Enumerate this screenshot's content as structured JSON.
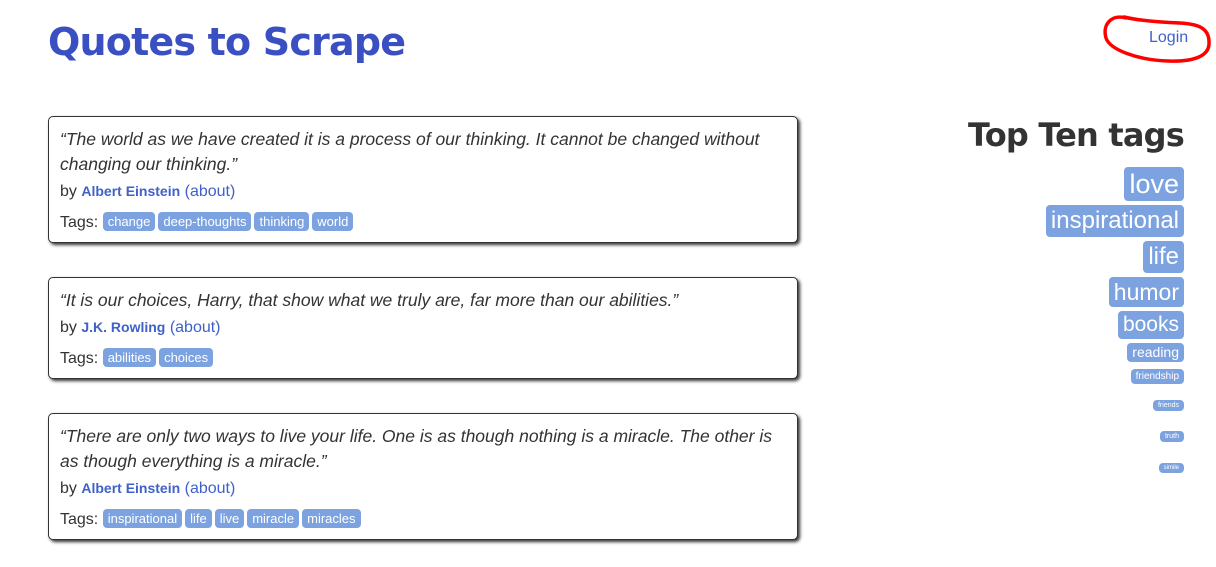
{
  "header": {
    "title": "Quotes to Scrape",
    "login_label": "Login"
  },
  "annotation_color": "#ff0000",
  "quotes": [
    {
      "text": "“The world as we have created it is a process of our thinking. It cannot be changed without changing our thinking.”",
      "by_label": "by",
      "author": "Albert Einstein",
      "about_label": "(about)",
      "tags_label": "Tags:",
      "tags": [
        "change",
        "deep-thoughts",
        "thinking",
        "world"
      ]
    },
    {
      "text": "“It is our choices, Harry, that show what we truly are, far more than our abilities.”",
      "by_label": "by",
      "author": "J.K. Rowling",
      "about_label": "(about)",
      "tags_label": "Tags:",
      "tags": [
        "abilities",
        "choices"
      ]
    },
    {
      "text": "“There are only two ways to live your life. One is as though nothing is a miracle. The other is as though everything is a miracle.”",
      "by_label": "by",
      "author": "Albert Einstein",
      "about_label": "(about)",
      "tags_label": "Tags:",
      "tags": [
        "inspirational",
        "life",
        "live",
        "miracle",
        "miracles"
      ]
    }
  ],
  "top_tags": {
    "heading": "Top Ten tags",
    "items": [
      "love",
      "inspirational",
      "life",
      "humor",
      "books",
      "reading",
      "friendship",
      "friends",
      "truth",
      "simile"
    ]
  },
  "colors": {
    "title": "#3a4fc1",
    "link": "#3f61c9",
    "tag_background": "#7ca3e0",
    "tag_text": "#ffffff"
  }
}
